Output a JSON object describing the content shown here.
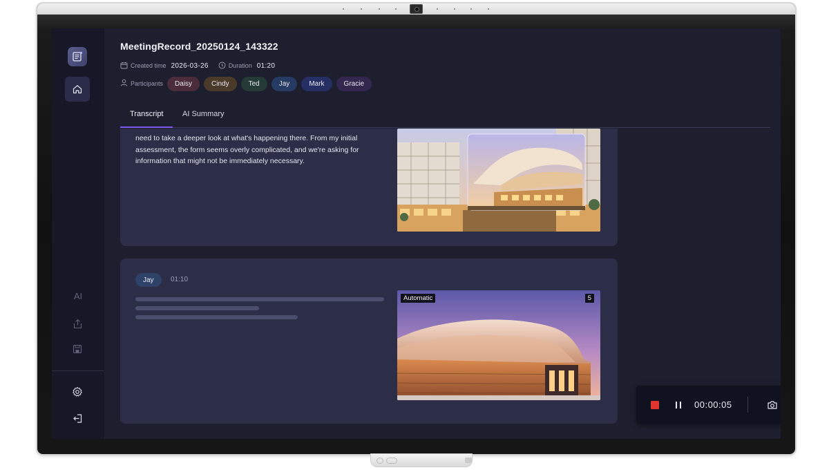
{
  "window": {
    "title": "MeetingRecord_20250124_143322"
  },
  "meta": {
    "created_label": "Created time",
    "created_value": "2026-03-26",
    "duration_label": "Duration",
    "duration_value": "01:20"
  },
  "participants": {
    "label": "Participants",
    "items": [
      {
        "name": "Daisy",
        "color": "#4b2c3a"
      },
      {
        "name": "Cindy",
        "color": "#4a3a2a"
      },
      {
        "name": "Ted",
        "color": "#233a36"
      },
      {
        "name": "Jay",
        "color": "#263b63"
      },
      {
        "name": "Mark",
        "color": "#262f63"
      },
      {
        "name": "Gracie",
        "color": "#33264f"
      }
    ]
  },
  "tabs": [
    {
      "label": "Transcript",
      "active": true
    },
    {
      "label": "AI Summary",
      "active": false
    }
  ],
  "transcript": [
    {
      "text": "need to take a deeper look at what's happening there. From my initial assessment, the form seems overly complicated, and we're asking for information that might not be immediately necessary.",
      "image": "modern-architecture-building"
    },
    {
      "speaker": "Jay",
      "time": "01:10",
      "image": "curved-roof-building",
      "image_badge": "Automatic",
      "image_count": "5"
    }
  ],
  "sidebar": {
    "ai_label": "AI",
    "icons": [
      "app-logo-icon",
      "home-icon",
      "share-icon",
      "save-icon",
      "settings-icon",
      "exit-icon"
    ]
  },
  "recorder": {
    "elapsed": "00:00:05",
    "icons": [
      "stop-icon",
      "pause-icon",
      "camera-icon",
      "more-icon"
    ],
    "stop_color": "#e0342e"
  },
  "colors": {
    "accent": "#7c5cf0",
    "background": "#1d1f2f",
    "card": "#2c2e48"
  }
}
